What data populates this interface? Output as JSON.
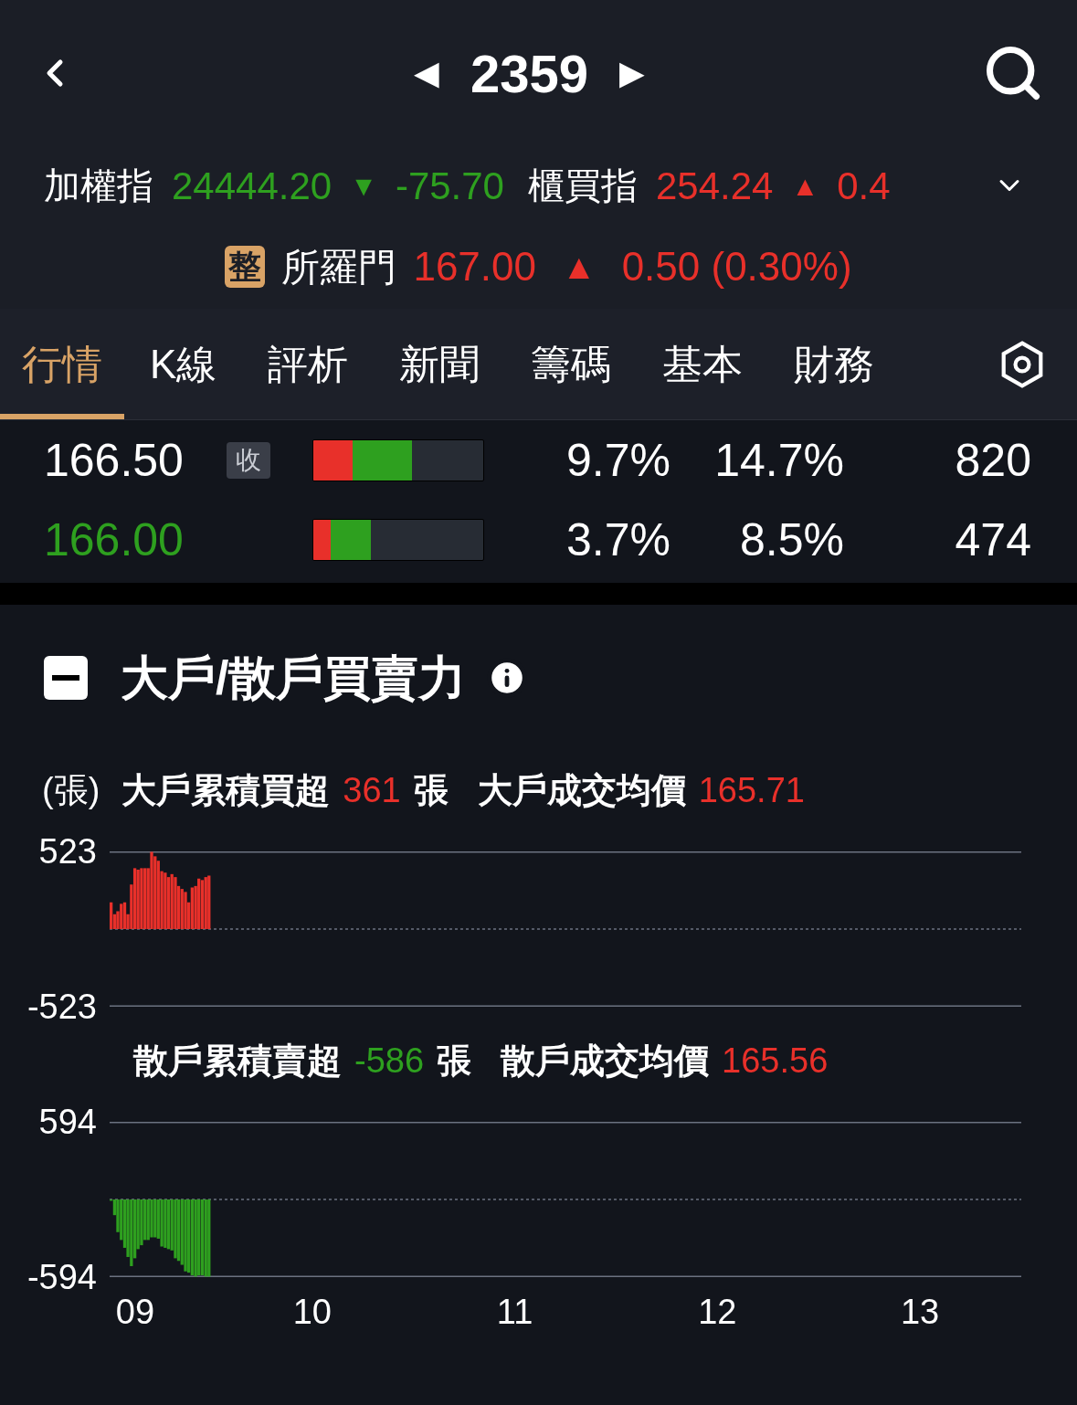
{
  "header": {
    "symbol": "2359",
    "prev_arrow": "◀",
    "next_arrow": "▶"
  },
  "indices": [
    {
      "name": "加權指",
      "value": "24444.20",
      "arrow": "▼",
      "change": "-75.70",
      "color": "#2ea01f"
    },
    {
      "name": "櫃買指",
      "value": "254.24",
      "arrow": "▲",
      "change": "0.4",
      "color": "#e8302a"
    }
  ],
  "stock": {
    "badge": "整",
    "name": "所羅門",
    "price": "167.00",
    "arrow": "▲",
    "change": "0.50 (0.30%)",
    "color": "#e8302a"
  },
  "tabs": [
    {
      "label": "行情",
      "selected": true
    },
    {
      "label": "K線",
      "selected": false
    },
    {
      "label": "評析",
      "selected": false
    },
    {
      "label": "新聞",
      "selected": false
    },
    {
      "label": "籌碼",
      "selected": false
    },
    {
      "label": "基本",
      "selected": false
    },
    {
      "label": "財務",
      "selected": false
    }
  ],
  "rows": [
    {
      "price": "166.50",
      "color": "#ffffff",
      "tag": "收",
      "bar": [
        {
          "level": 0.23,
          "color": "#e8302a"
        },
        {
          "level": 0.35,
          "color": "#2ea01f"
        }
      ],
      "column_2": "9.7%",
      "column_3": "14.7%",
      "column_4": "820"
    },
    {
      "price": "166.00",
      "color": "#2ea01f",
      "bar": [
        {
          "level": 0.1,
          "color": "#e8302a"
        },
        {
          "level": 0.24,
          "color": "#2ea01f"
        }
      ],
      "column_2": "3.7%",
      "column_3": "8.5%",
      "column_4": "474"
    }
  ],
  "section": {
    "title": "大戶/散戶買賣力",
    "expanded": true,
    "panels": [
      {
        "unit": "(張)",
        "label": "大戶累積買超",
        "value": "361",
        "color": "#e8302a",
        "value_unit": "張",
        "avg_label": "大戶成交均價",
        "avg_value": "165.71",
        "chart_data": {
          "type": "bar",
          "x": [
            9.0,
            9.017,
            9.033,
            9.05,
            9.067,
            9.083,
            9.1,
            9.117,
            9.133,
            9.15,
            9.167,
            9.183,
            9.2,
            9.217,
            9.233,
            9.25,
            9.267,
            9.283,
            9.3,
            9.317,
            9.333,
            9.35,
            9.367,
            9.383,
            9.4,
            9.417,
            9.433,
            9.45,
            9.467,
            9.483
          ],
          "series": [
            {
              "color": "#e8302a",
              "values": [
                180,
                100,
                120,
                170,
                180,
                100,
                300,
                410,
                400,
                410,
                410,
                410,
                520,
                490,
                460,
                390,
                380,
                350,
                370,
                350,
                290,
                270,
                250,
                180,
                280,
                290,
                340,
                330,
                350,
                360
              ]
            }
          ],
          "xlim": [
            9,
            13.5
          ],
          "ylim": [
            -523,
            523
          ],
          "yticks": [
            523,
            -523
          ],
          "ref_lines": [
            {
              "axis": "y",
              "value": 0
            }
          ]
        }
      },
      {
        "label": "散戶累積賣超",
        "value": "-586",
        "color": "#2ea01f",
        "value_unit": "張",
        "avg_label": "散戶成交均價",
        "avg_value": "165.56",
        "chart_data": {
          "type": "bar",
          "x": [
            9.0,
            9.017,
            9.033,
            9.05,
            9.067,
            9.083,
            9.1,
            9.117,
            9.133,
            9.15,
            9.167,
            9.183,
            9.2,
            9.217,
            9.233,
            9.25,
            9.267,
            9.283,
            9.3,
            9.317,
            9.333,
            9.35,
            9.367,
            9.383,
            9.4,
            9.417,
            9.433,
            9.45,
            9.467,
            9.483
          ],
          "series": [
            {
              "color": "#2ea01f",
              "values": [
                -10,
                -120,
                -250,
                -310,
                -370,
                -440,
                -510,
                -450,
                -380,
                -350,
                -310,
                -310,
                -290,
                -290,
                -300,
                -360,
                -370,
                -380,
                -390,
                -450,
                -470,
                -500,
                -550,
                -560,
                -580,
                -590,
                -580,
                -580,
                -590,
                -590
              ]
            }
          ],
          "xlim": [
            9,
            13.5
          ],
          "ylim": [
            -594,
            594
          ],
          "yticks": [
            594,
            -594
          ],
          "ref_lines": [
            {
              "axis": "y",
              "value": 0
            }
          ],
          "xticks": [
            {
              "value": 9,
              "label": "09"
            },
            {
              "value": 10,
              "label": "10"
            },
            {
              "value": 11,
              "label": "11"
            },
            {
              "value": 12,
              "label": "12"
            },
            {
              "value": 13,
              "label": "13"
            }
          ]
        }
      }
    ]
  }
}
